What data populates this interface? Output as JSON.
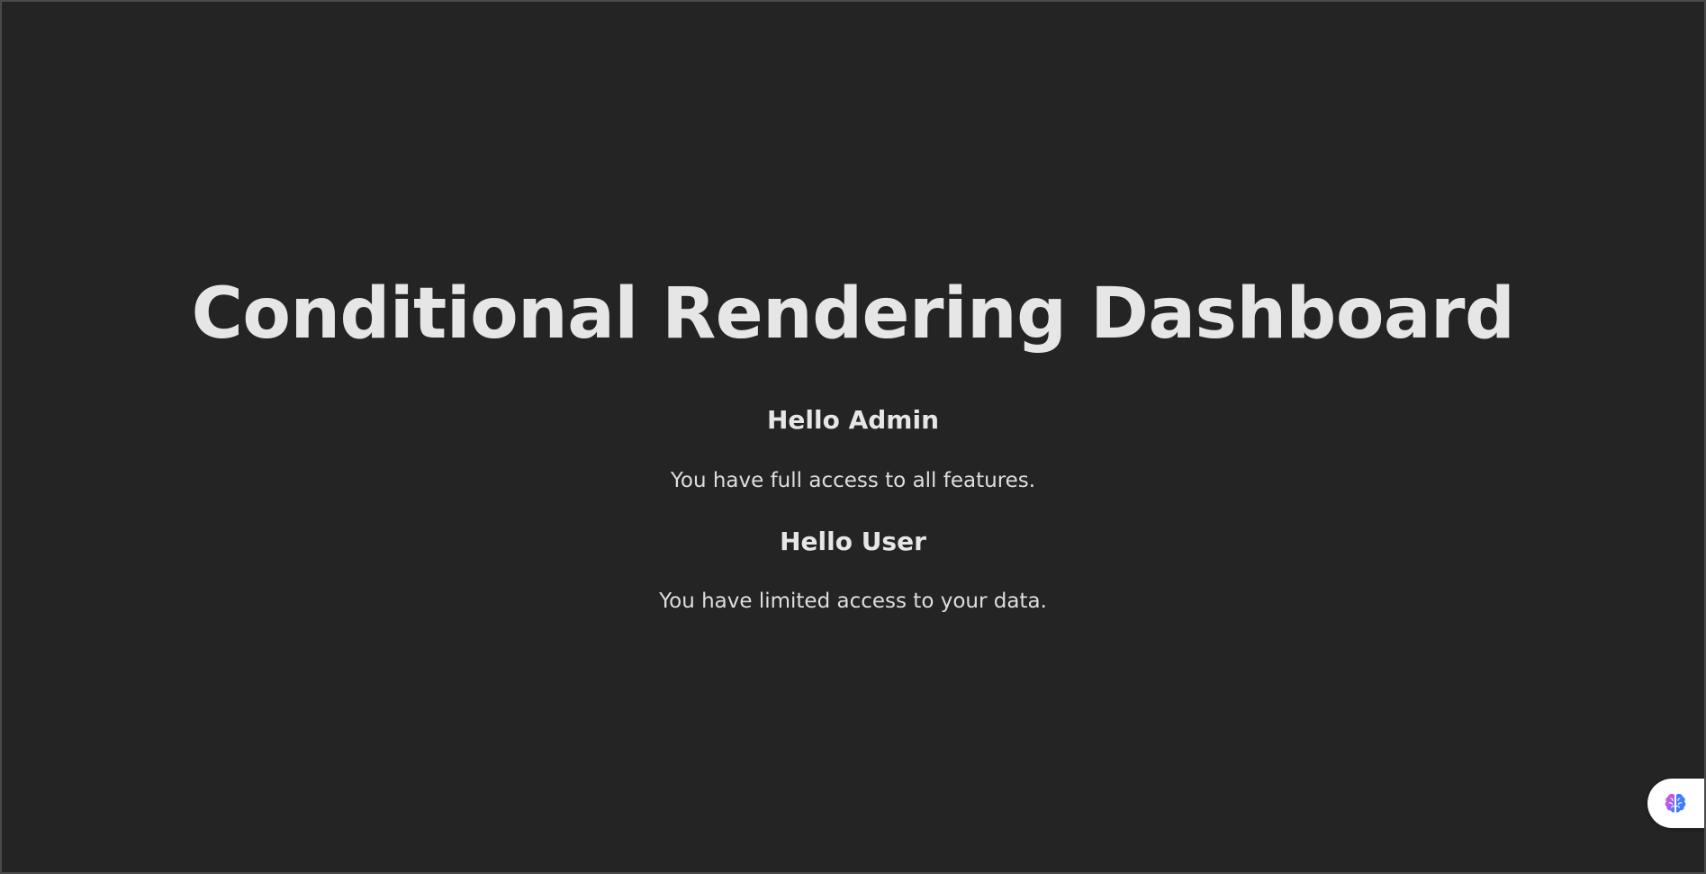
{
  "dashboard": {
    "title": "Conditional Rendering Dashboard",
    "admin": {
      "heading": "Hello Admin",
      "message": "You have full access to all features."
    },
    "user": {
      "heading": "Hello User",
      "message": "You have limited access to your data."
    }
  },
  "widget": {
    "icon": "brain-icon",
    "colors": {
      "left": "#ff4fa3",
      "right": "#3d7bff",
      "center": "#a45cff"
    }
  },
  "theme": {
    "background": "#242424",
    "text": "#e6e6e6"
  }
}
